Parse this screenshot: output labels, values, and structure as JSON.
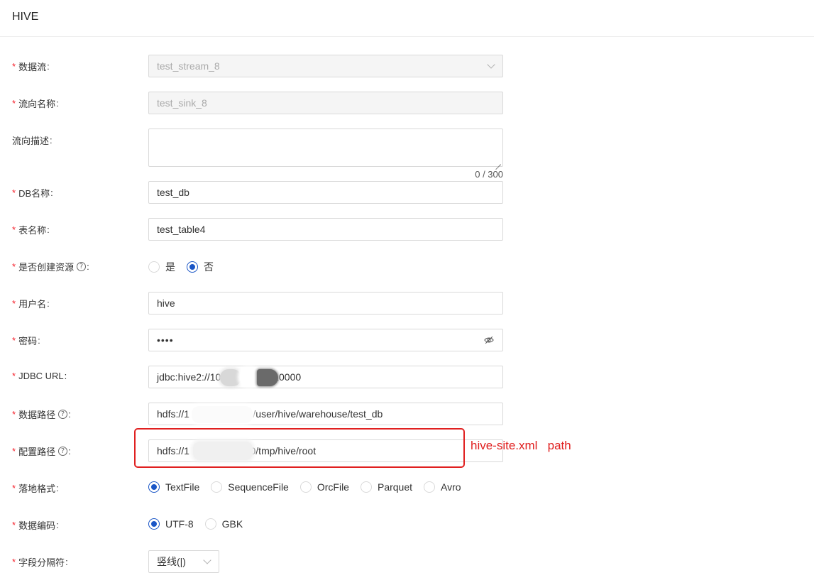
{
  "header": {
    "title": "HIVE"
  },
  "form": {
    "stream": {
      "label": "数据流",
      "value": "test_stream_8"
    },
    "sink_name": {
      "label": "流向名称",
      "value": "test_sink_8"
    },
    "description": {
      "label": "流向描述",
      "value": "",
      "counter": "0 / 300"
    },
    "db_name": {
      "label": "DB名称",
      "value": "test_db"
    },
    "table_name": {
      "label": "表名称",
      "value": "test_table4"
    },
    "create_resource": {
      "label": "是否创建资源",
      "options": [
        "是",
        "否"
      ],
      "selected": "否"
    },
    "username": {
      "label": "用户名",
      "value": "hive"
    },
    "password": {
      "label": "密码",
      "value": "••••"
    },
    "jdbc_url": {
      "label": "JDBC URL",
      "value": "jdbc:hive2://10.10           9:10000"
    },
    "data_path": {
      "label": "数据路径",
      "value": "hdfs://1              :9000/user/hive/warehouse/test_db"
    },
    "config_path": {
      "label": "配置路径",
      "value": "hdfs://1               :9000/tmp/hive/root"
    },
    "file_format": {
      "label": "落地格式",
      "options": [
        "TextFile",
        "SequenceFile",
        "OrcFile",
        "Parquet",
        "Avro"
      ],
      "selected": "TextFile"
    },
    "encoding": {
      "label": "数据编码",
      "options": [
        "UTF-8",
        "GBK"
      ],
      "selected": "UTF-8"
    },
    "separator": {
      "label": "字段分隔符",
      "value": "竖线(|)"
    }
  },
  "annotation": {
    "text": "hive-site.xml   path",
    "color": "#e02020"
  },
  "colors": {
    "accent": "#1a56c6",
    "required": "#f5222d"
  }
}
